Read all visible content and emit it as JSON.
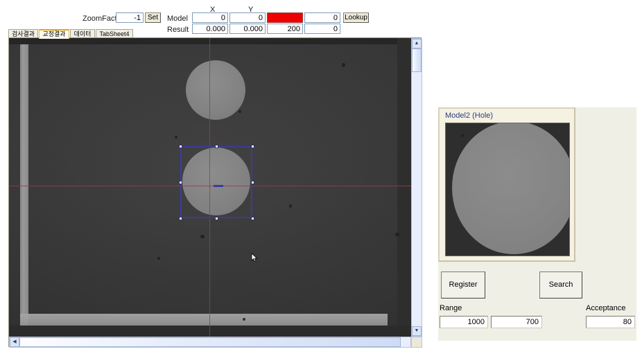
{
  "toolbar": {
    "zoomfactor_label": "ZoomFactor",
    "zoomfactor_value": "-1",
    "set_button": "Set",
    "col_x": "X",
    "col_y": "Y",
    "model_label": "Model",
    "result_label": "Result",
    "lookup_button": "Lookup",
    "model_row": [
      "0",
      "0",
      "",
      "0"
    ],
    "result_row": [
      "0.000",
      "0.000",
      "200",
      "0"
    ],
    "model_alarm_color": "#ee0000"
  },
  "tabs": [
    {
      "label": "검사결과",
      "active": false
    },
    {
      "label": "교정결과",
      "active": true
    },
    {
      "label": "데이터",
      "active": false
    },
    {
      "label": "TabSheet4",
      "active": false
    }
  ],
  "viewer": {
    "scroll_up_icon": "▲",
    "scroll_down_icon": "▼",
    "scroll_left_icon": "◀",
    "scroll_right_icon": "▶",
    "cursor_icon": "move-resize-cursor"
  },
  "panel": {
    "group_title": "Model2 (Hole)",
    "register_button": "Register",
    "search_button": "Search",
    "range_label": "Range",
    "range_value_1": "1000",
    "range_value_2": "700",
    "acceptance_label": "Acceptance",
    "acceptance_value": "80"
  }
}
